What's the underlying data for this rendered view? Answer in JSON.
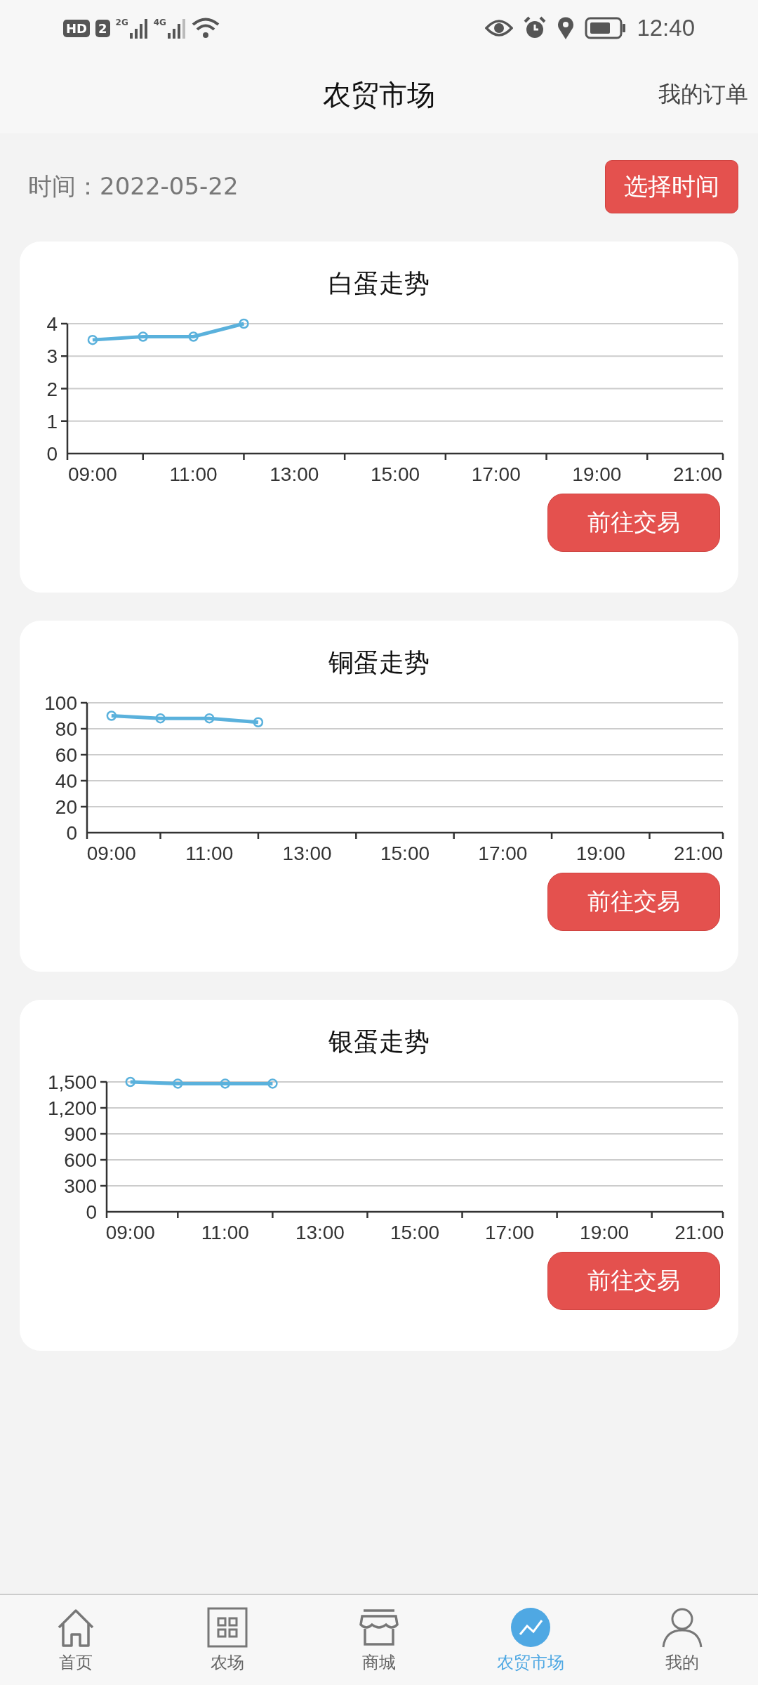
{
  "status_bar": {
    "hd": "HD",
    "sim": "2",
    "signals": [
      "2G",
      "4G"
    ],
    "time": "12:40"
  },
  "header": {
    "title": "农贸市场",
    "action": "我的订单"
  },
  "date_row": {
    "label": "时间：",
    "date": "2022-05-22",
    "button": "选择时间"
  },
  "cards": [
    {
      "title": "白蛋走势",
      "button": "前往交易",
      "chart_data": {
        "type": "line",
        "x": [
          9,
          10,
          11,
          12
        ],
        "grid": true,
        "series": [
          {
            "color": "#5ab1dc",
            "marker": true,
            "values": [
              3.5,
              3.6,
              3.6,
              4
            ]
          }
        ],
        "xlim": [
          8.5,
          21.5
        ],
        "ylim": [
          0,
          4
        ],
        "yticks": [
          0,
          1,
          2,
          3,
          4
        ],
        "xticks": [
          {
            "value": 9,
            "label": "09:00"
          },
          {
            "value": 11,
            "label": "11:00"
          },
          {
            "value": 13,
            "label": "13:00"
          },
          {
            "value": 15,
            "label": "15:00"
          },
          {
            "value": 17,
            "label": "17:00"
          },
          {
            "value": 19,
            "label": "19:00"
          },
          {
            "value": 21,
            "label": "21:00"
          }
        ]
      }
    },
    {
      "title": "铜蛋走势",
      "button": "前往交易",
      "chart_data": {
        "type": "line",
        "x": [
          9,
          10,
          11,
          12
        ],
        "grid": true,
        "series": [
          {
            "color": "#5ab1dc",
            "marker": true,
            "values": [
              90,
              88,
              88,
              85
            ]
          }
        ],
        "xlim": [
          8.5,
          21.5
        ],
        "ylim": [
          0,
          100
        ],
        "yticks": [
          0,
          20,
          40,
          60,
          80,
          100
        ],
        "xticks": [
          {
            "value": 9,
            "label": "09:00"
          },
          {
            "value": 11,
            "label": "11:00"
          },
          {
            "value": 13,
            "label": "13:00"
          },
          {
            "value": 15,
            "label": "15:00"
          },
          {
            "value": 17,
            "label": "17:00"
          },
          {
            "value": 19,
            "label": "19:00"
          },
          {
            "value": 21,
            "label": "21:00"
          }
        ]
      }
    },
    {
      "title": "银蛋走势",
      "button": "前往交易",
      "chart_data": {
        "type": "line",
        "x": [
          9,
          10,
          11,
          12
        ],
        "grid": true,
        "series": [
          {
            "color": "#5ab1dc",
            "marker": true,
            "values": [
              1500,
              1480,
              1480,
              1480
            ]
          }
        ],
        "xlim": [
          8.5,
          21.5
        ],
        "ylim": [
          0,
          1500
        ],
        "yticks": [
          {
            "value": 0,
            "label": "0"
          },
          {
            "value": 300,
            "label": "300"
          },
          {
            "value": 600,
            "label": "600"
          },
          {
            "value": 900,
            "label": "900"
          },
          {
            "value": 1200,
            "label": "1,200"
          },
          {
            "value": 1500,
            "label": "1,500"
          }
        ],
        "xticks": [
          {
            "value": 9,
            "label": "09:00"
          },
          {
            "value": 11,
            "label": "11:00"
          },
          {
            "value": 13,
            "label": "13:00"
          },
          {
            "value": 15,
            "label": "15:00"
          },
          {
            "value": 17,
            "label": "17:00"
          },
          {
            "value": 19,
            "label": "19:00"
          },
          {
            "value": 21,
            "label": "21:00"
          }
        ]
      }
    }
  ],
  "tab_bar": [
    {
      "label": "首页",
      "kind": "home",
      "selected": false
    },
    {
      "label": "农场",
      "kind": "grid",
      "selected": false
    },
    {
      "label": "商城",
      "kind": "shop",
      "selected": false
    },
    {
      "label": "农贸市场",
      "kind": "trend",
      "selected": true
    },
    {
      "label": "我的",
      "kind": "person",
      "selected": false
    }
  ]
}
